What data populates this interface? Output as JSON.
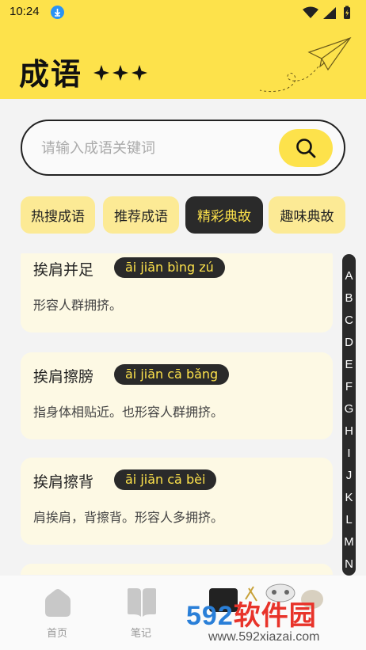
{
  "status_bar": {
    "time": "10:24"
  },
  "header": {
    "title": "成语"
  },
  "search": {
    "placeholder": "请输入成语关键词"
  },
  "tabs": [
    {
      "label": "热搜成语",
      "active": false
    },
    {
      "label": "推荐成语",
      "active": false
    },
    {
      "label": "精彩典故",
      "active": true
    },
    {
      "label": "趣味典故",
      "active": false
    }
  ],
  "idioms": [
    {
      "word": "挨肩并足",
      "pinyin": "āi jiān bìng zú",
      "meaning": "形容人群拥挤。"
    },
    {
      "word": "挨肩擦膀",
      "pinyin": "āi jiān cā bǎng",
      "meaning": "指身体相贴近。也形容人群拥挤。"
    },
    {
      "word": "挨肩擦背",
      "pinyin": "āi jiān cā bèi",
      "meaning": "肩挨肩，背擦背。形容人多拥挤。"
    }
  ],
  "index_letters": [
    "A",
    "B",
    "C",
    "D",
    "E",
    "F",
    "G",
    "H",
    "I",
    "J",
    "K",
    "L",
    "M",
    "N"
  ],
  "bottom_nav": [
    {
      "label": "首页"
    },
    {
      "label": "笔记"
    }
  ],
  "watermark": {
    "digits": "592",
    "name": "软件园",
    "url": "www.592xiazai.com"
  },
  "colors": {
    "accent_yellow": "#fde24b",
    "dark": "#2a2a2a",
    "card_bg": "#fdf9e4",
    "tab_bg": "#fcea95"
  }
}
